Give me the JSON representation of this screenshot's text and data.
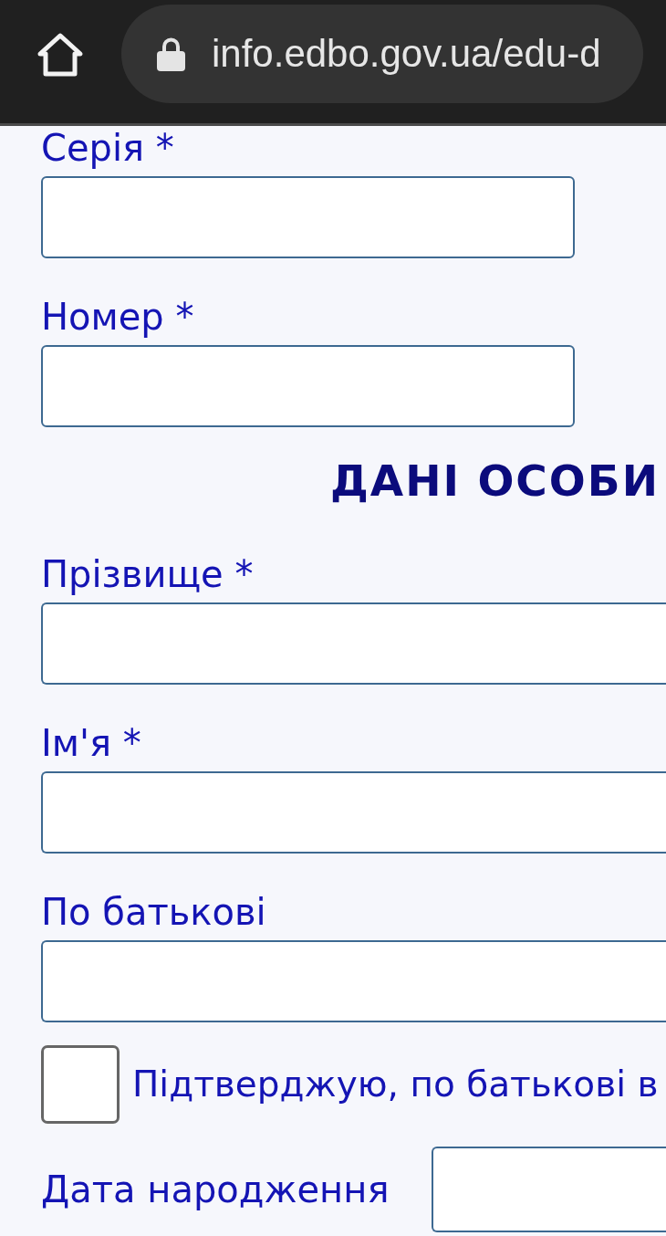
{
  "browser": {
    "url": "info.edbo.gov.ua/edu-d",
    "secure": true
  },
  "document_fields": [
    {
      "label": "Серія *"
    },
    {
      "label": "Номер *"
    }
  ],
  "section": {
    "heading": "ДАНІ ОСОБИ"
  },
  "person_fields": [
    {
      "label": "Прізвище *"
    },
    {
      "label": "Ім'я *"
    },
    {
      "label": "По батькові"
    }
  ],
  "confirm": {
    "label": "Підтверджую, по батькові в",
    "checked": false
  },
  "birth_date": {
    "label": "Дата народження"
  }
}
